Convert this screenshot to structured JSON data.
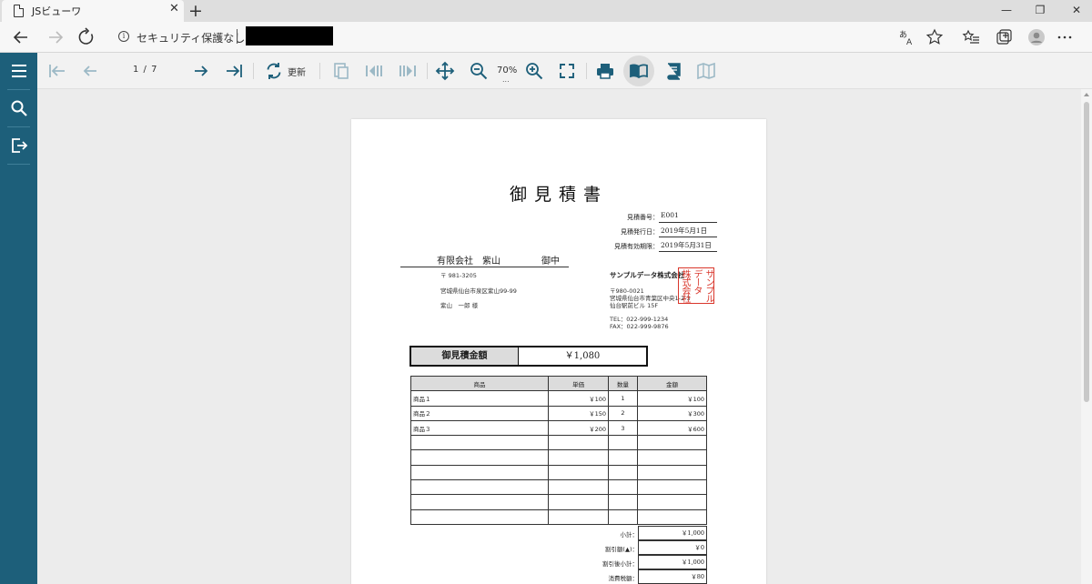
{
  "browser": {
    "tab_title": "JSビューワ",
    "tab_close": "✕",
    "new_tab": "+",
    "address_security": "セキュリティ保護なし",
    "window_controls": {
      "minimize": "—",
      "restore": "❐",
      "close": "✕"
    }
  },
  "toolbar": {
    "page_indicator": "1 / 7",
    "refresh_label": "更新",
    "zoom_level": "70%",
    "zoom_more": "..."
  },
  "document": {
    "title": "御見積書",
    "meta": [
      {
        "label": "見積番号：",
        "value": "E001"
      },
      {
        "label": "見積発行日：",
        "value": "2019年5月1日"
      },
      {
        "label": "見積有効期限：",
        "value": "2019年5月31日"
      }
    ],
    "customer": {
      "name": "有限会社　紫山",
      "honorific": "御中",
      "postal": "〒 981-3205",
      "address": "宮城県仙台市泉区紫山99-99",
      "person": "紫山　一郎 様"
    },
    "issuer": {
      "name": "サンプルデータ株式会社",
      "postal": "〒980-0021",
      "address1": "宮城県仙台市青葉区中央1-2-3",
      "address2": "仙台駅前ビル 15F",
      "tel": "TEL：022-999-1234",
      "fax": "FAX：022-999-9876"
    },
    "seal": {
      "col1": "サンプル",
      "col2": "データ",
      "col3": "株式会社"
    },
    "total": {
      "label": "御見積金額",
      "value": "￥1,080"
    },
    "items_table": {
      "headers": [
        "商品",
        "単価",
        "数量",
        "金額"
      ],
      "rows": [
        [
          "商品１",
          "￥100",
          "1",
          "￥100"
        ],
        [
          "商品２",
          "￥150",
          "2",
          "￥300"
        ],
        [
          "商品３",
          "￥200",
          "3",
          "￥600"
        ],
        [
          "",
          "",
          "",
          ""
        ],
        [
          "",
          "",
          "",
          ""
        ],
        [
          "",
          "",
          "",
          ""
        ],
        [
          "",
          "",
          "",
          ""
        ],
        [
          "",
          "",
          "",
          ""
        ],
        [
          "",
          "",
          "",
          ""
        ]
      ]
    },
    "summary": [
      {
        "label": "小計：",
        "value": "￥1,000"
      },
      {
        "label": "割引額(▲)：",
        "value": "￥0"
      },
      {
        "label": "割引後小計：",
        "value": "￥1,000"
      },
      {
        "label": "消費税額：",
        "value": "￥80"
      }
    ]
  },
  "colors": {
    "sidebar": "#1d5f7a",
    "toolbar_icon": "#1d5f7a",
    "toolbar_icon_disabled": "#9cb9c6",
    "seal_red": "#d9362b"
  },
  "icons": {
    "sidebar": [
      "hamburger-menu-icon",
      "search-icon",
      "exit-icon"
    ],
    "toolbar": [
      "first-page-icon",
      "previous-page-icon",
      "next-page-icon",
      "last-page-icon",
      "refresh-icon",
      "copy-page-icon",
      "play-backward-icon",
      "play-forward-icon",
      "move-icon",
      "zoom-out-icon",
      "zoom-in-icon",
      "fullscreen-icon",
      "print-icon",
      "book-open-icon",
      "book-single-icon",
      "book-gallery-icon"
    ]
  }
}
